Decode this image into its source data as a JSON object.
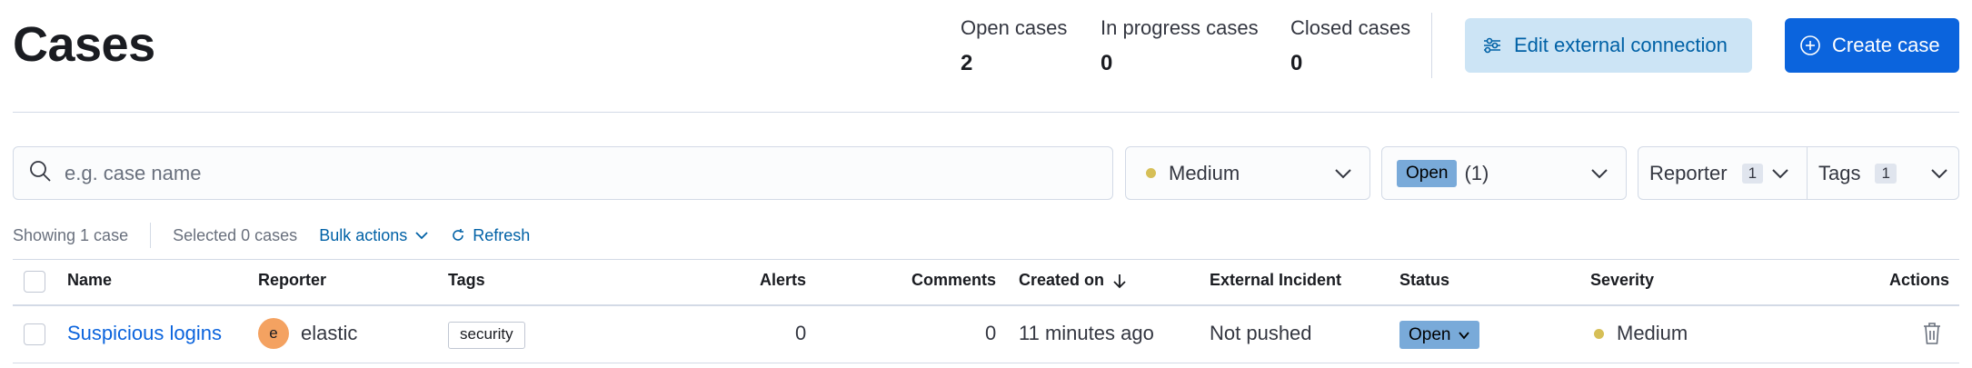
{
  "page": {
    "title": "Cases"
  },
  "stats": [
    {
      "label": "Open cases",
      "value": "2"
    },
    {
      "label": "In progress cases",
      "value": "0"
    },
    {
      "label": "Closed cases",
      "value": "0"
    }
  ],
  "buttons": {
    "edit_connection": "Edit external connection",
    "create_case": "Create case"
  },
  "filters": {
    "search_placeholder": "e.g. case name",
    "severity": "Medium",
    "status_badge": "Open",
    "status_count": "(1)",
    "reporter_label": "Reporter",
    "reporter_count": "1",
    "tags_label": "Tags",
    "tags_count": "1"
  },
  "toolbar": {
    "showing": "Showing 1 case",
    "selected": "Selected 0 cases",
    "bulk_actions": "Bulk actions",
    "refresh": "Refresh"
  },
  "table": {
    "headers": {
      "name": "Name",
      "reporter": "Reporter",
      "tags": "Tags",
      "alerts": "Alerts",
      "comments": "Comments",
      "created_on": "Created on",
      "external_incident": "External Incident",
      "status": "Status",
      "severity": "Severity",
      "actions": "Actions"
    },
    "rows": [
      {
        "name": "Suspicious logins",
        "reporter_initial": "e",
        "reporter": "elastic",
        "tag": "security",
        "alerts": "0",
        "comments": "0",
        "created_on": "11 minutes ago",
        "external_incident": "Not pushed",
        "status": "Open",
        "severity": "Medium"
      }
    ]
  },
  "colors": {
    "primary": "#0b64dd",
    "severity_medium": "#d6bf57",
    "status_open": "#79aad9",
    "avatar": "#f4a261"
  },
  "icons": [
    "connection-settings-icon",
    "plus-circle-icon",
    "search-icon",
    "chevron-down-icon",
    "refresh-icon",
    "arrow-down-icon",
    "trash-icon"
  ]
}
